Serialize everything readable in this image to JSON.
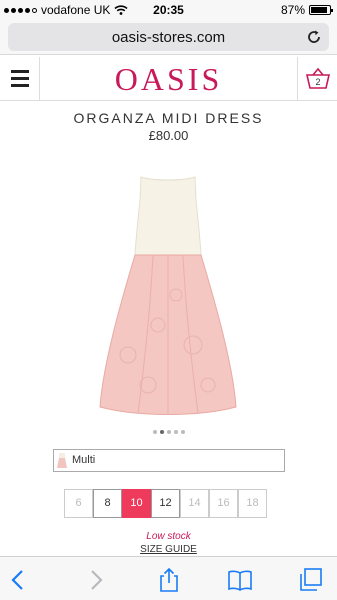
{
  "status_bar": {
    "carrier": "vodafone UK",
    "time": "20:35",
    "battery": "87%",
    "battery_level": 0.87
  },
  "browser": {
    "url": "oasis-stores.com"
  },
  "header": {
    "logo_text": "OASIS",
    "basket_count": "2"
  },
  "product": {
    "title": "ORGANZA MIDI DRESS",
    "price": "£80.00",
    "image_count": 5,
    "active_image": 2,
    "colour": "Multi",
    "sizes": [
      {
        "label": "6",
        "state": "unavailable"
      },
      {
        "label": "8",
        "state": "available"
      },
      {
        "label": "10",
        "state": "selected"
      },
      {
        "label": "12",
        "state": "available"
      },
      {
        "label": "14",
        "state": "unavailable"
      },
      {
        "label": "16",
        "state": "unavailable"
      },
      {
        "label": "18",
        "state": "unavailable"
      }
    ],
    "stock_message": "Low stock",
    "size_guide_label": "SIZE GUIDE"
  },
  "toolbar": {
    "icons": [
      "back-icon",
      "forward-icon",
      "share-icon",
      "bookmarks-icon",
      "tabs-icon"
    ]
  },
  "colors": {
    "brand": "#c8195a",
    "selected_size": "#ee3b5b",
    "ios_blue": "#1a7cf5"
  }
}
